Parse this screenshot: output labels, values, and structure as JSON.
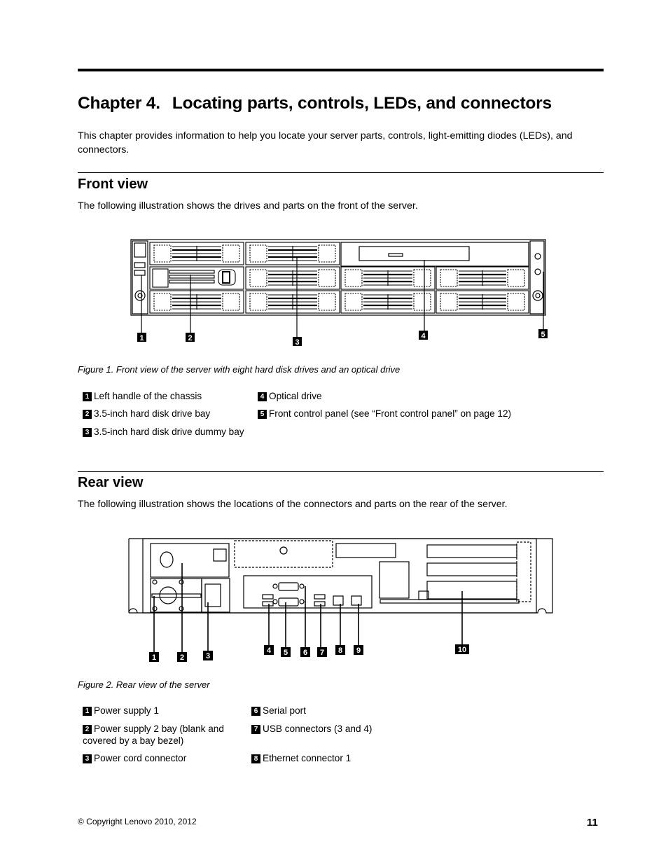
{
  "chapter": {
    "number": "Chapter 4.",
    "title": "Locating parts, controls, LEDs, and connectors",
    "intro": "This chapter provides information to help you locate your server parts, controls, light-emitting diodes (LEDs), and connectors."
  },
  "front_view": {
    "heading": "Front view",
    "text": "The following illustration shows the drives and parts on the front of the server.",
    "figure_caption": "Figure 1.  Front view of the server with eight hard disk drives and an optical drive",
    "callouts": [
      "1",
      "2",
      "3",
      "4",
      "5"
    ],
    "legend": [
      {
        "num": "1",
        "label": "Left handle of the chassis"
      },
      {
        "num": "2",
        "label": "3.5-inch hard disk drive bay"
      },
      {
        "num": "3",
        "label": "3.5-inch hard disk drive dummy bay"
      },
      {
        "num": "4",
        "label": "Optical drive"
      },
      {
        "num": "5",
        "label": "Front control panel (see “Front control panel” on page 12)"
      }
    ]
  },
  "rear_view": {
    "heading": "Rear view",
    "text": "The following illustration shows the locations of the connectors and parts on the rear of the server.",
    "figure_caption": "Figure 2.  Rear view of the server",
    "callouts": [
      "1",
      "2",
      "3",
      "4",
      "5",
      "6",
      "7",
      "8",
      "9",
      "10"
    ],
    "legend": [
      {
        "num": "1",
        "label": "Power supply 1"
      },
      {
        "num": "2",
        "label": "Power supply 2 bay (blank and covered by a bay bezel)"
      },
      {
        "num": "3",
        "label": "Power cord connector"
      },
      {
        "num": "6",
        "label": "Serial port"
      },
      {
        "num": "7",
        "label": "USB connectors (3 and 4)"
      },
      {
        "num": "8",
        "label": "Ethernet connector 1"
      }
    ]
  },
  "footer": {
    "copyright": "© Copyright Lenovo 2010, 2012",
    "page_number": "11"
  }
}
